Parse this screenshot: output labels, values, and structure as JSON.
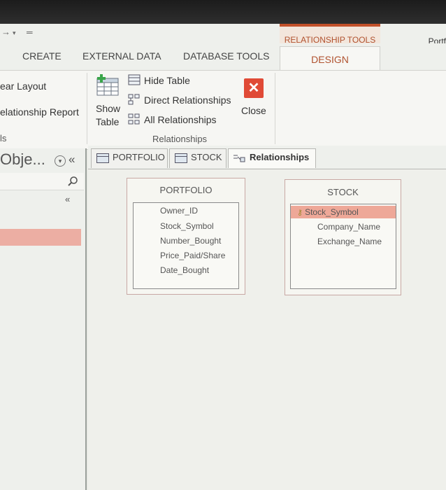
{
  "app": {
    "window_title_partial": "Portf",
    "contextual_group": "RELATIONSHIP TOOLS",
    "accent_color": "#c2512a"
  },
  "ribbon_tabs": [
    "CREATE",
    "EXTERNAL DATA",
    "DATABASE TOOLS",
    "DESIGN"
  ],
  "ribbon": {
    "tools_items": [
      "ear Layout",
      "elationship Report"
    ],
    "tools_group_label": "ls",
    "show_table": {
      "line1": "Show",
      "line2": "Table"
    },
    "hide_table": "Hide Table",
    "direct_relationships": "Direct Relationships",
    "all_relationships": "All Relationships",
    "close": "Close",
    "group_label": "Relationships"
  },
  "nav_pane": {
    "title": "Obje...",
    "collapse": "«"
  },
  "doc_tabs": [
    {
      "label": "PORTFOLIO",
      "active": false
    },
    {
      "label": "STOCK",
      "active": false
    },
    {
      "label": "Relationships",
      "active": true
    }
  ],
  "tables": [
    {
      "name": "PORTFOLIO",
      "fields": [
        "Owner_ID",
        "Stock_Symbol",
        "Number_Bought",
        "Price_Paid/Share",
        "Date_Bought"
      ],
      "primary_key": null
    },
    {
      "name": "STOCK",
      "fields": [
        "Stock_Symbol",
        "Company_Name",
        "Exchange_Name"
      ],
      "primary_key": "Stock_Symbol"
    }
  ]
}
